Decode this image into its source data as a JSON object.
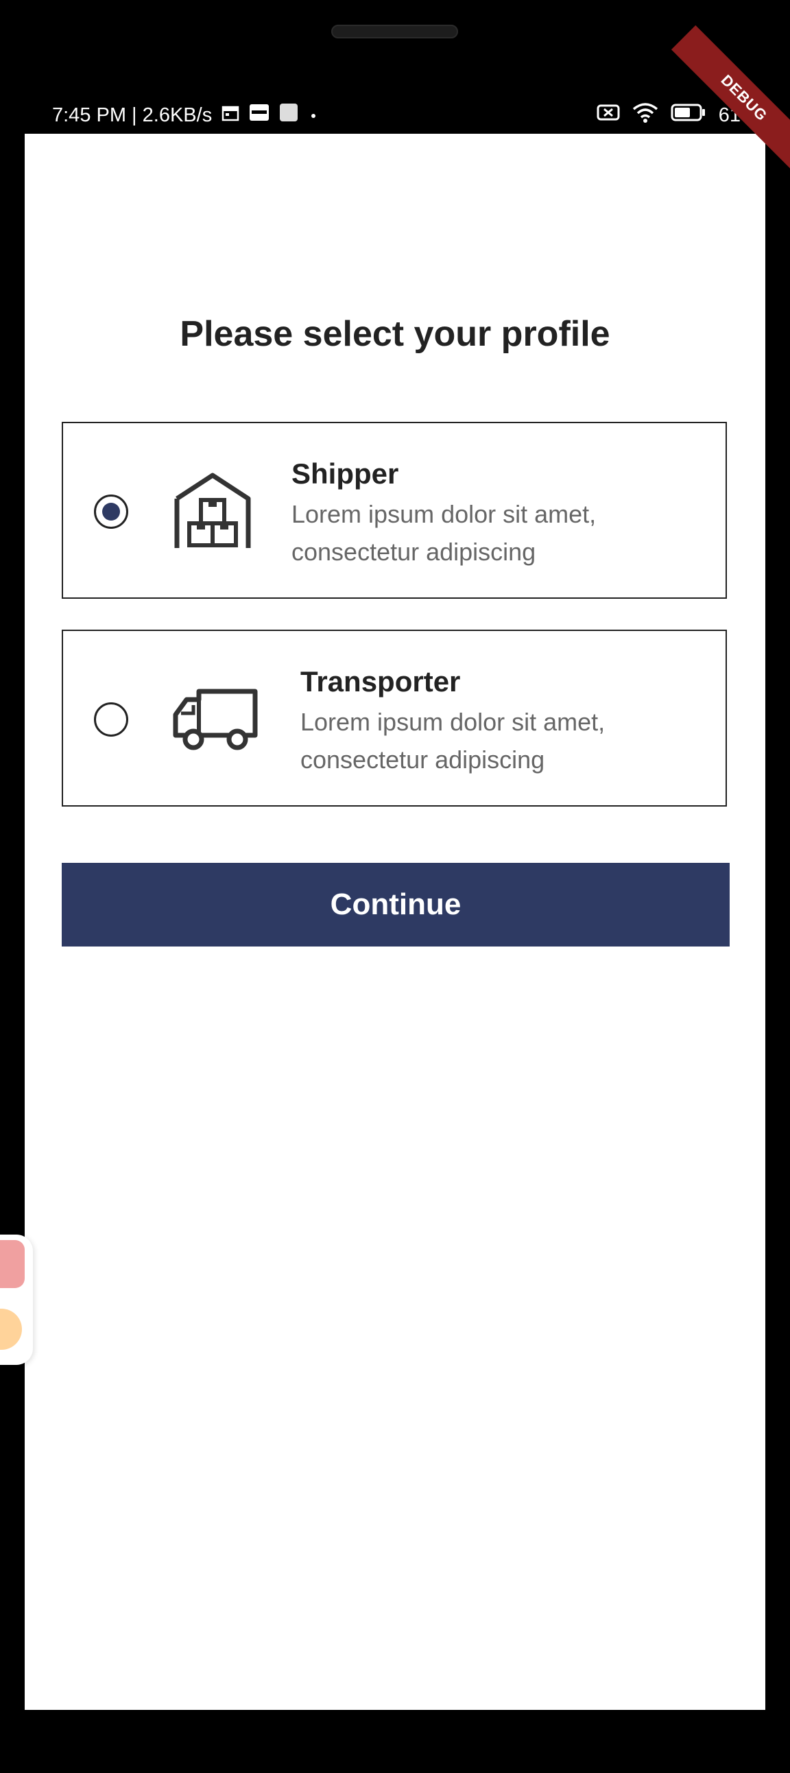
{
  "status_bar": {
    "time_speed": "7:45 PM | 2.6KB/s",
    "battery_percent": "61",
    "debug_banner": "DEBUG"
  },
  "page": {
    "title": "Please select your profile"
  },
  "options": [
    {
      "title": "Shipper",
      "description": "Lorem ipsum dolor sit amet, consectetur adipiscing",
      "icon": "warehouse-icon",
      "selected": true
    },
    {
      "title": "Transporter",
      "description": "Lorem ipsum dolor sit amet, consectetur adipiscing",
      "icon": "truck-icon",
      "selected": false
    }
  ],
  "actions": {
    "continue_label": "Continue"
  },
  "colors": {
    "primary": "#2e3a63",
    "text_dark": "#222222",
    "text_muted": "#666666"
  }
}
